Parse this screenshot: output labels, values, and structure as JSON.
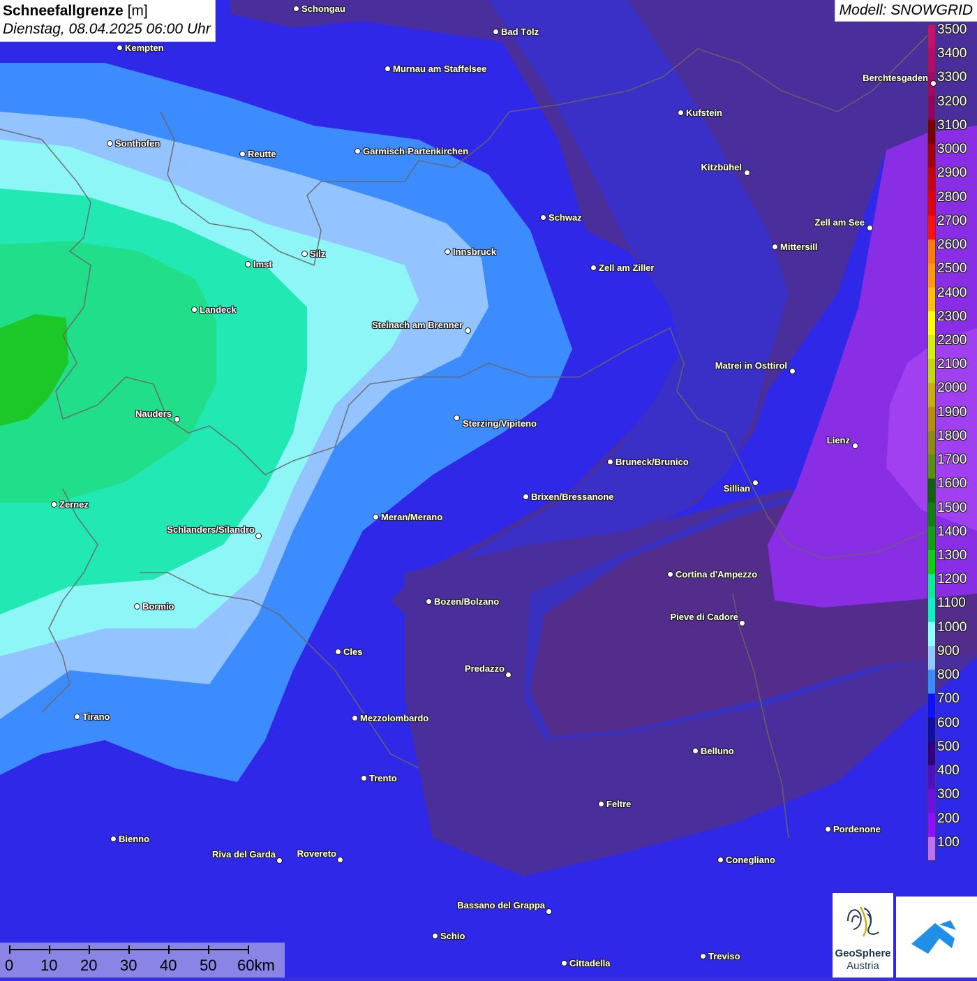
{
  "header": {
    "title": "Schneefallgrenze",
    "unit": "[m]",
    "date": "Dienstag, 08.04.2025 06:00 Uhr",
    "model": "Modell: SNOWGRID"
  },
  "legend": {
    "levels": [
      {
        "label": "3500",
        "color": "#c8106e"
      },
      {
        "label": "3400",
        "color": "#b40c6a"
      },
      {
        "label": "3300",
        "color": "#a00a66"
      },
      {
        "label": "3200",
        "color": "#8c0662"
      },
      {
        "label": "3100",
        "color": "#780000"
      },
      {
        "label": "3000",
        "color": "#a00010"
      },
      {
        "label": "2900",
        "color": "#c80010"
      },
      {
        "label": "2800",
        "color": "#e00010"
      },
      {
        "label": "2700",
        "color": "#ff1010"
      },
      {
        "label": "2600",
        "color": "#ff7a10"
      },
      {
        "label": "2500",
        "color": "#ff9a10"
      },
      {
        "label": "2400",
        "color": "#ffbe10"
      },
      {
        "label": "2300",
        "color": "#ffff10"
      },
      {
        "label": "2200",
        "color": "#d4f010"
      },
      {
        "label": "2100",
        "color": "#c4d810"
      },
      {
        "label": "2000",
        "color": "#c4b010"
      },
      {
        "label": "1900",
        "color": "#b49010"
      },
      {
        "label": "1800",
        "color": "#8c8c10"
      },
      {
        "label": "1700",
        "color": "#5a9010"
      },
      {
        "label": "1600",
        "color": "#106010"
      },
      {
        "label": "1500",
        "color": "#108010"
      },
      {
        "label": "1400",
        "color": "#10a010"
      },
      {
        "label": "1300",
        "color": "#10d010"
      },
      {
        "label": "1200",
        "color": "#10e89a"
      },
      {
        "label": "1100",
        "color": "#10f0c8"
      },
      {
        "label": "1000",
        "color": "#90ffff"
      },
      {
        "label": "900",
        "color": "#90c8ff"
      },
      {
        "label": "800",
        "color": "#3c8cff"
      },
      {
        "label": "700",
        "color": "#1010ff"
      },
      {
        "label": "600",
        "color": "#1010a0"
      },
      {
        "label": "500",
        "color": "#300080"
      },
      {
        "label": "400",
        "color": "#5010c0"
      },
      {
        "label": "300",
        "color": "#7010e0"
      },
      {
        "label": "200",
        "color": "#9010ff"
      },
      {
        "label": "100",
        "color": "#c070f0"
      }
    ]
  },
  "cities": [
    {
      "name": "Schongau"
    },
    {
      "name": "Bad Tölz"
    },
    {
      "name": "Kempten"
    },
    {
      "name": "Murnau am Staffelsee"
    },
    {
      "name": "Kufstein"
    },
    {
      "name": "Berchtesgaden"
    },
    {
      "name": "Sonthofen"
    },
    {
      "name": "Reutte"
    },
    {
      "name": "Garmisch-Partenkirchen"
    },
    {
      "name": "Kitzbühel"
    },
    {
      "name": "Schwaz"
    },
    {
      "name": "Zell am See"
    },
    {
      "name": "Mittersill"
    },
    {
      "name": "Innsbruck"
    },
    {
      "name": "Silz"
    },
    {
      "name": "Imst"
    },
    {
      "name": "Zell am Ziller"
    },
    {
      "name": "Landeck"
    },
    {
      "name": "Steinach am Brenner"
    },
    {
      "name": "Matrei in Osttirol"
    },
    {
      "name": "Nauders"
    },
    {
      "name": "Sterzing/Vipiteno"
    },
    {
      "name": "Lienz"
    },
    {
      "name": "Bruneck/Brunico"
    },
    {
      "name": "Sillian"
    },
    {
      "name": "Brixen/Bressanone"
    },
    {
      "name": "Zernez"
    },
    {
      "name": "Meran/Merano"
    },
    {
      "name": "Schlanders/Silandro"
    },
    {
      "name": "Cortina d'Ampezzo"
    },
    {
      "name": "Bozen/Bolzano"
    },
    {
      "name": "Bormio"
    },
    {
      "name": "Pieve di Cadore"
    },
    {
      "name": "Cles"
    },
    {
      "name": "Predazzo"
    },
    {
      "name": "Tirano"
    },
    {
      "name": "Mezzolombardo"
    },
    {
      "name": "Belluno"
    },
    {
      "name": "Trento"
    },
    {
      "name": "Feltre"
    },
    {
      "name": "Pordenone"
    },
    {
      "name": "Bienno"
    },
    {
      "name": "Riva del Garda"
    },
    {
      "name": "Rovereto"
    },
    {
      "name": "Conegliano"
    },
    {
      "name": "Bassano del Grappa"
    },
    {
      "name": "Schio"
    },
    {
      "name": "Treviso"
    },
    {
      "name": "Cittadella"
    }
  ],
  "scalebar": {
    "ticks": [
      "0",
      "10",
      "20",
      "30",
      "40",
      "50",
      "60km"
    ]
  },
  "logos": {
    "geosphere_line1": "GeoSphere",
    "geosphere_line2": "Austria"
  }
}
